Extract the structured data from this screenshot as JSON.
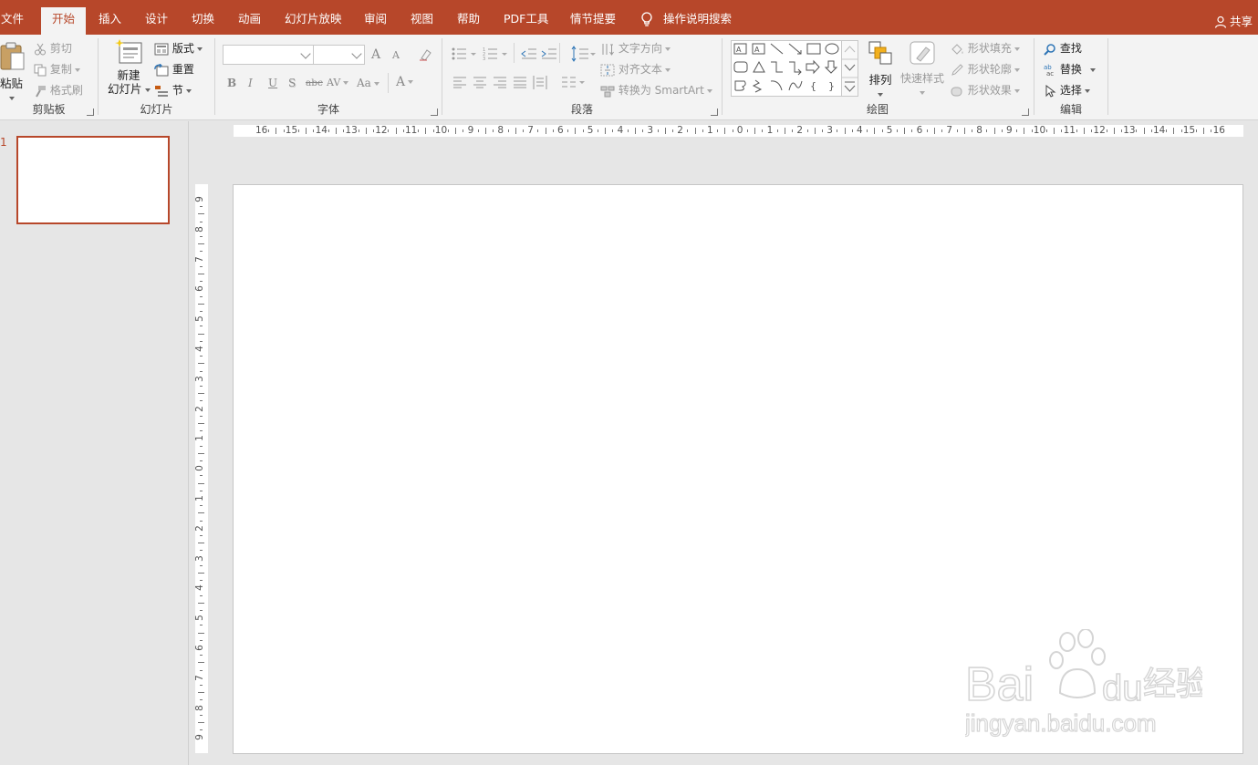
{
  "tabs": [
    {
      "label": "文件",
      "active": false
    },
    {
      "label": "开始",
      "active": true
    },
    {
      "label": "插入",
      "active": false
    },
    {
      "label": "设计",
      "active": false
    },
    {
      "label": "切换",
      "active": false
    },
    {
      "label": "动画",
      "active": false
    },
    {
      "label": "幻灯片放映",
      "active": false
    },
    {
      "label": "审阅",
      "active": false
    },
    {
      "label": "视图",
      "active": false
    },
    {
      "label": "帮助",
      "active": false
    },
    {
      "label": "PDF工具",
      "active": false
    },
    {
      "label": "情节提要",
      "active": false
    }
  ],
  "search": {
    "label": "操作说明搜索",
    "icon": "lightbulb-icon"
  },
  "share": {
    "label": "共享",
    "icon": "person-icon"
  },
  "clipboard": {
    "group_label": "剪贴板",
    "paste": "粘贴",
    "cut": "剪切",
    "copy": "复制",
    "format_painter": "格式刷"
  },
  "slides_group": {
    "group_label": "幻灯片",
    "new_slide_line1": "新建",
    "new_slide_line2": "幻灯片",
    "layout": "版式",
    "reset": "重置",
    "section": "节"
  },
  "font": {
    "group_label": "字体",
    "grow": "A",
    "shrink": "A",
    "bold": "B",
    "italic": "I",
    "underline": "U",
    "shadow": "S",
    "strike": "abc",
    "spacing": "AV",
    "case": "Aa",
    "color": "A"
  },
  "paragraph": {
    "group_label": "段落",
    "text_direction": "文字方向",
    "align_text": "对齐文本",
    "smartart": "转换为 SmartArt"
  },
  "drawing": {
    "group_label": "绘图",
    "arrange": "排列",
    "quick_styles": "快速样式",
    "shape_fill": "形状填充",
    "shape_outline": "形状轮廓",
    "shape_effects": "形状效果"
  },
  "editing": {
    "group_label": "编辑",
    "find": "查找",
    "replace": "替换",
    "select": "选择"
  },
  "slide_panel": {
    "slide_number": "1"
  },
  "hruler_labels": [
    "16",
    "15",
    "14",
    "13",
    "12",
    "11",
    "10",
    "9",
    "8",
    "7",
    "6",
    "5",
    "4",
    "3",
    "2",
    "1",
    "0",
    "1",
    "2",
    "3",
    "4",
    "5",
    "6",
    "7",
    "8",
    "9",
    "10",
    "11",
    "12",
    "13",
    "14",
    "15",
    "16"
  ],
  "vruler_labels": [
    "9",
    "8",
    "7",
    "6",
    "5",
    "4",
    "3",
    "2",
    "1",
    "0",
    "1",
    "2",
    "3",
    "4",
    "5",
    "6",
    "7",
    "8",
    "9"
  ],
  "watermark": {
    "brand": "Baidu经验",
    "url": "jingyan.baidu.com"
  },
  "colors": {
    "accent": "#b7472a",
    "ribbon_bg": "#f3f3f3",
    "workspace_bg": "#e6e6e6"
  }
}
